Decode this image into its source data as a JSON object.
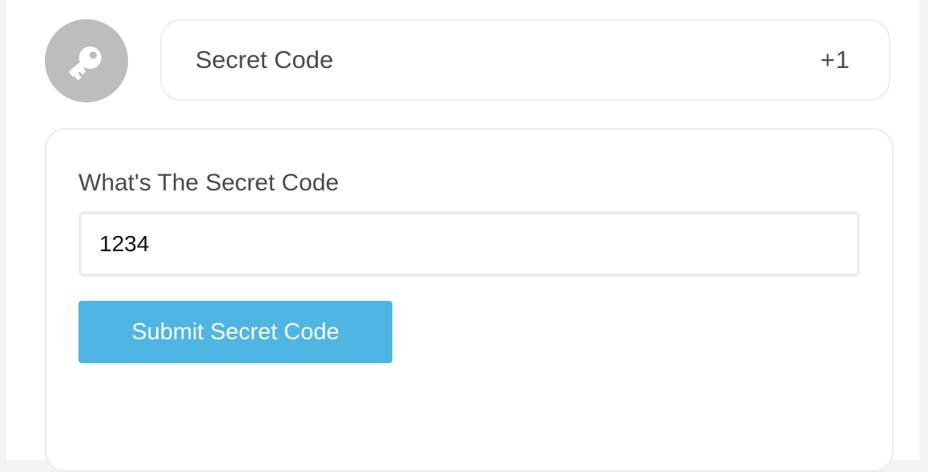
{
  "header": {
    "avatar_icon": "key-icon",
    "title": "Secret Code",
    "points": "+1"
  },
  "form": {
    "label": "What's The Secret Code",
    "input_value": "1234",
    "submit_label": "Submit Secret Code"
  },
  "colors": {
    "accent": "#4fb6e3",
    "avatar_bg": "#bdbdbd"
  }
}
